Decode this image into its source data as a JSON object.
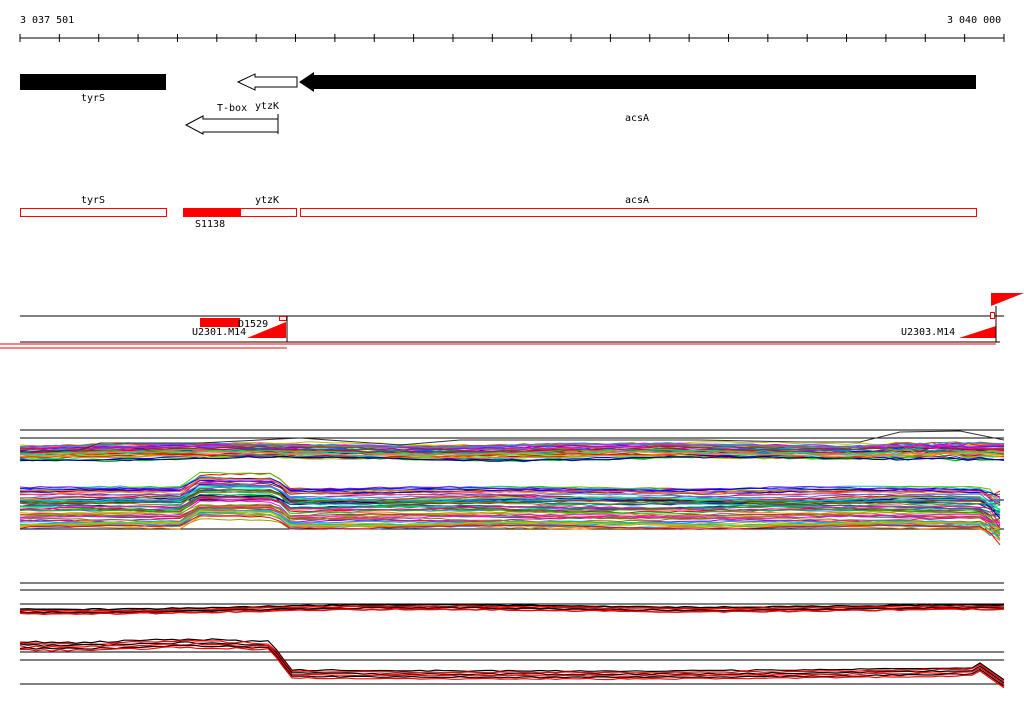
{
  "ruler": {
    "start_label": "3 037 501",
    "end_label": "3 040 000"
  },
  "annotated_genes": {
    "tyrS": "tyrS",
    "tbox": "T-box",
    "ytzK": "ytzK",
    "acsA": "acsA"
  },
  "transcript_genes": {
    "tyrS": "tyrS",
    "ytzK": "ytzK",
    "acsA": "acsA",
    "segment": "S1138"
  },
  "tus": {
    "u2301": "U2301.M14",
    "d1529": "D1529",
    "u2303": "U2303.M14"
  },
  "colors": {
    "gene_fill": "#000000",
    "highlight": "#ff0000",
    "track_line": "#000000"
  }
}
